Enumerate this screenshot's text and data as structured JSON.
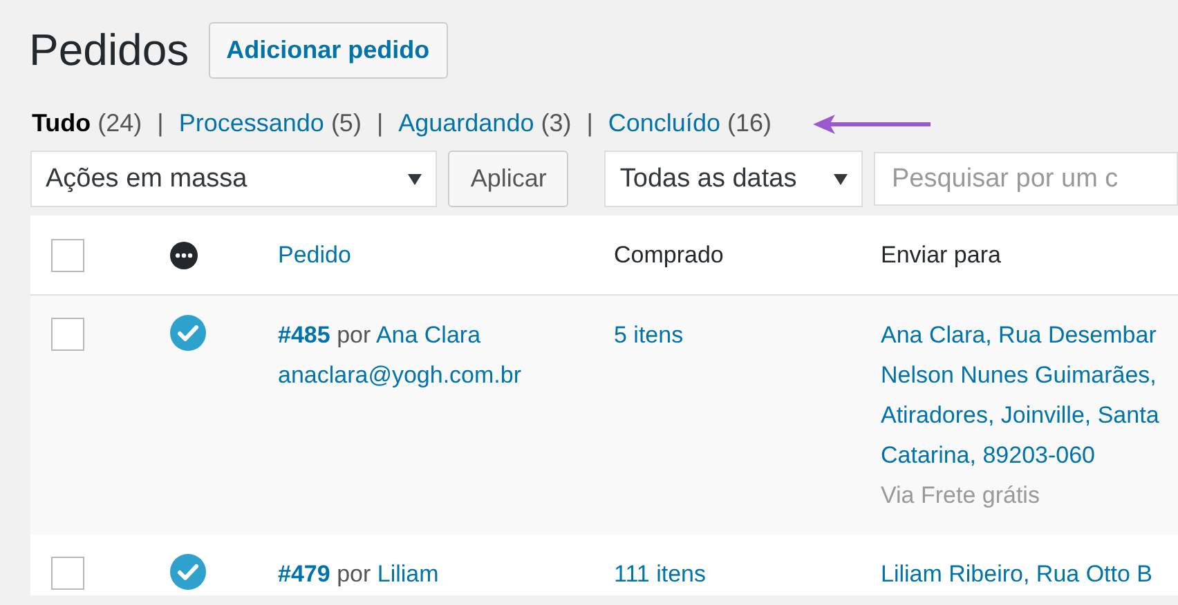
{
  "title": "Pedidos",
  "add_button": "Adicionar pedido",
  "status_filters": [
    {
      "label": "Tudo",
      "count": "(24)",
      "selected": true
    },
    {
      "label": "Processando",
      "count": "(5)",
      "selected": false
    },
    {
      "label": "Aguardando",
      "count": "(3)",
      "selected": false
    },
    {
      "label": "Concluído",
      "count": "(16)",
      "selected": false
    }
  ],
  "separator": "|",
  "bulk_actions": {
    "value": "Ações em massa"
  },
  "apply_button": "Aplicar",
  "date_filter": {
    "value": "Todas as datas"
  },
  "search": {
    "placeholder": "Pesquisar por um c"
  },
  "table": {
    "select_all": {
      "checked": false
    },
    "columns": [
      "Pedido",
      "Comprado",
      "Enviar para"
    ],
    "rows": [
      {
        "selected": false,
        "completed": true,
        "number": "#485",
        "by": "por",
        "customer": "Ana Clara",
        "email": "anaclara@yogh.com.br",
        "items": "5 itens",
        "address_lines": [
          "Ana Clara, Rua Desembar",
          "Nelson Nunes Guimarães,",
          "Atiradores, Joinville, Santa",
          "Catarina, 89203-060"
        ],
        "shipping": "Via Frete grátis"
      },
      {
        "selected": false,
        "completed": true,
        "number": "#479",
        "by": "por",
        "customer": "Liliam",
        "items": "111 itens",
        "address_lines": [
          "Liliam Ribeiro, Rua Otto B"
        ]
      }
    ]
  }
}
